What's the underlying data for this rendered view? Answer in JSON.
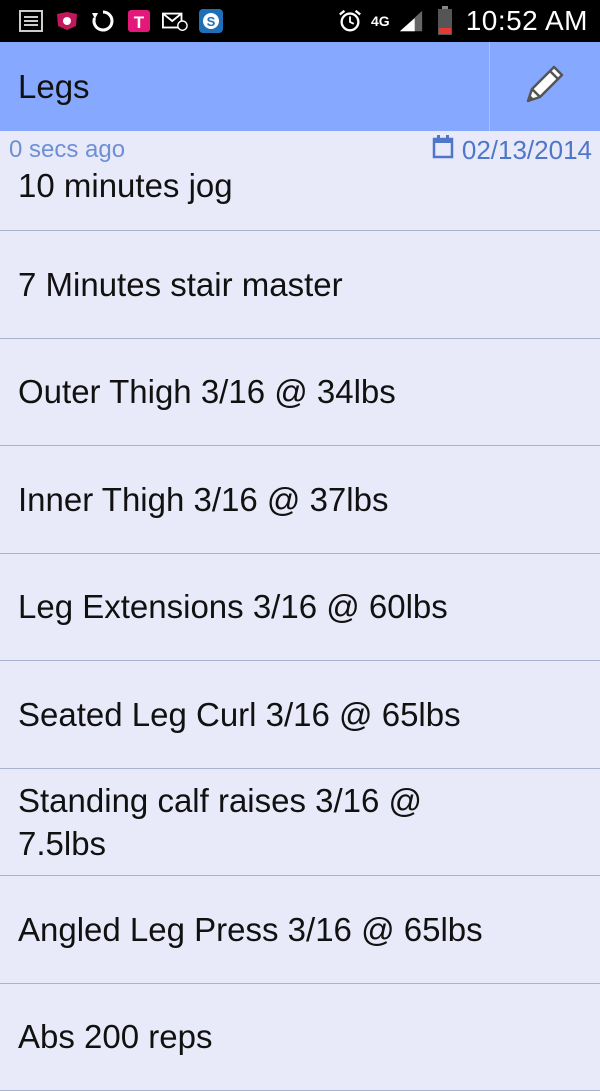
{
  "status_bar": {
    "time": "10:52 AM",
    "network": "4G",
    "icons": [
      "notification-list-icon",
      "voicemail-icon",
      "sync-icon",
      "tmobile-icon",
      "email-icon",
      "skype-icon",
      "alarm-icon",
      "signal-icon",
      "battery-icon"
    ]
  },
  "action_bar": {
    "title": "Legs",
    "edit_icon": "pencil-icon"
  },
  "meta": {
    "updated": "0 secs ago",
    "date": "02/13/2014"
  },
  "items": [
    {
      "label": "10 minutes jog"
    },
    {
      "label": "7 Minutes stair master"
    },
    {
      "label": "Outer Thigh 3/16 @ 34lbs"
    },
    {
      "label": "Inner Thigh 3/16 @ 37lbs"
    },
    {
      "label": "Leg Extensions 3/16 @ 60lbs"
    },
    {
      "label": "Seated Leg Curl 3/16 @ 65lbs"
    },
    {
      "label": "Standing calf raises 3/16 @ 7.5lbs"
    },
    {
      "label": "Angled Leg Press 3/16 @ 65lbs"
    },
    {
      "label": "Abs 200 reps"
    }
  ],
  "colors": {
    "action_bar": "#86a8ff",
    "background": "#e9eaf9",
    "meta_text": "#4f76c9"
  }
}
